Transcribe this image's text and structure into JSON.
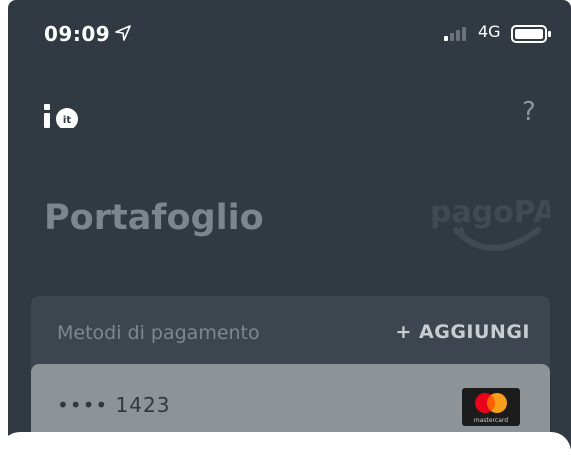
{
  "status_bar": {
    "time": "09:09",
    "network": "4G",
    "location_icon": "location-arrow-icon",
    "signal_icon": "signal-icon",
    "battery_icon": "battery-icon"
  },
  "header": {
    "logo_icon": "io-logo-icon",
    "help_label": "?"
  },
  "page": {
    "title": "Portafoglio",
    "brand_logo_icon": "pagopa-logo-icon"
  },
  "payment_methods": {
    "title": "Metodi di pagamento",
    "add_label": "+ AGGIUNGI",
    "cards": [
      {
        "number": "•••• 1423",
        "brand": "mastercard"
      }
    ]
  },
  "colors": {
    "background": "#313a42",
    "card": "#3d464e",
    "credit_card": "#8e9398",
    "accent_red": "#eb001b",
    "accent_orange": "#f79e1b"
  }
}
